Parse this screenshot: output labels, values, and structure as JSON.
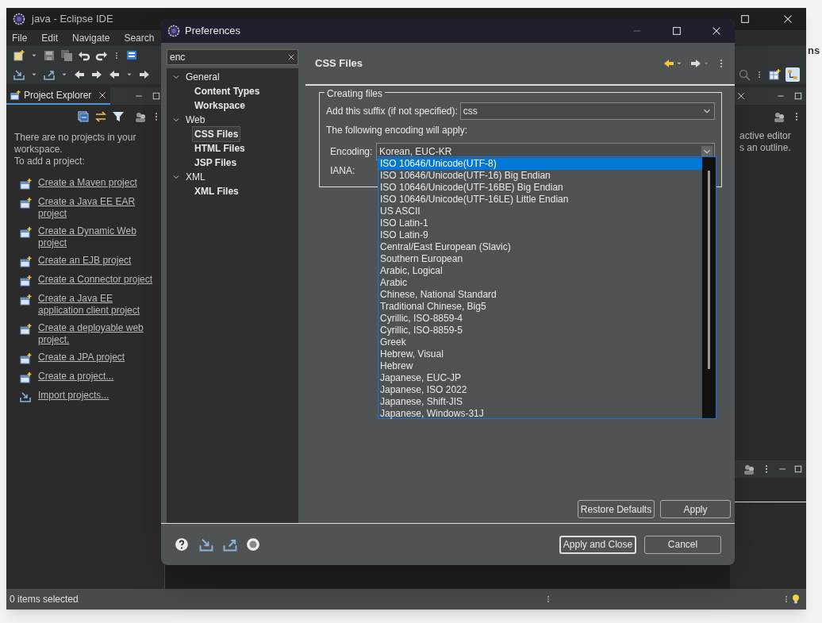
{
  "main_window": {
    "title": "java - Eclipse IDE",
    "menu": [
      "File",
      "Edit",
      "Navigate",
      "Search"
    ]
  },
  "project_explorer": {
    "tab": "Project Explorer",
    "message": "There are no projects in your workspace.",
    "prompt": "To add a project:",
    "links": [
      {
        "label": "Create a Maven project"
      },
      {
        "label": "Create a Java EE EAR project"
      },
      {
        "label": "Create a Dynamic Web project"
      },
      {
        "label": "Create an EJB project"
      },
      {
        "label": "Create a Connector project"
      },
      {
        "label": "Create a Java EE application client project"
      },
      {
        "label": "Create a deployable web project."
      },
      {
        "label": "Create a JPA project"
      },
      {
        "label": "Create a project..."
      },
      {
        "label": "Import projects..."
      }
    ]
  },
  "outline": {
    "lines": [
      "active editor",
      "s an outline."
    ]
  },
  "background_window": {
    "text": "ns"
  },
  "status_bar": {
    "text": "0 items selected"
  },
  "preferences": {
    "title": "Preferences",
    "filter": "enc",
    "tree": [
      {
        "label": "General",
        "expanded": true,
        "selected": false,
        "children": [
          {
            "label": "Content Types",
            "selected": false
          },
          {
            "label": "Workspace",
            "selected": false
          }
        ]
      },
      {
        "label": "Web",
        "expanded": true,
        "selected": false,
        "children": [
          {
            "label": "CSS Files",
            "selected": true
          },
          {
            "label": "HTML Files",
            "selected": false
          },
          {
            "label": "JSP Files",
            "selected": false
          }
        ]
      },
      {
        "label": "XML",
        "expanded": true,
        "selected": false,
        "children": [
          {
            "label": "XML Files",
            "selected": false
          }
        ]
      }
    ],
    "page_title": "CSS Files",
    "group_title": "Creating files",
    "suffix_label": "Add this suffix (if not specified):",
    "suffix_value": "css",
    "encoding_note": "The following encoding will apply:",
    "encoding_label": "Encoding:",
    "encoding_value": "Korean, EUC-KR",
    "iana_label": "IANA:",
    "encoding_options": [
      {
        "label": "ISO 10646/Unicode(UTF-8)",
        "selected": true
      },
      {
        "label": "ISO 10646/Unicode(UTF-16) Big Endian",
        "selected": false
      },
      {
        "label": "ISO 10646/Unicode(UTF-16BE) Big Endian",
        "selected": false
      },
      {
        "label": "ISO 10646/Unicode(UTF-16LE) Little Endian",
        "selected": false
      },
      {
        "label": "US ASCII",
        "selected": false
      },
      {
        "label": "ISO Latin-1",
        "selected": false
      },
      {
        "label": "ISO Latin-9",
        "selected": false
      },
      {
        "label": "Central/East European (Slavic)",
        "selected": false
      },
      {
        "label": "Southern European",
        "selected": false
      },
      {
        "label": "Arabic, Logical",
        "selected": false
      },
      {
        "label": "Arabic",
        "selected": false
      },
      {
        "label": "Chinese, National Standard",
        "selected": false
      },
      {
        "label": "Traditional Chinese, Big5",
        "selected": false
      },
      {
        "label": "Cyrillic, ISO-8859-4",
        "selected": false
      },
      {
        "label": "Cyrillic, ISO-8859-5",
        "selected": false
      },
      {
        "label": "Greek",
        "selected": false
      },
      {
        "label": "Hebrew, Visual",
        "selected": false
      },
      {
        "label": "Hebrew",
        "selected": false
      },
      {
        "label": "Japanese, EUC-JP",
        "selected": false
      },
      {
        "label": "Japanese, ISO 2022",
        "selected": false
      },
      {
        "label": "Japanese, Shift-JIS",
        "selected": false
      },
      {
        "label": "Japanese, Windows-31J",
        "selected": false
      }
    ],
    "page_buttons": [
      "Restore Defaults",
      "Apply"
    ],
    "dialog_buttons": [
      {
        "label": "Apply and Close",
        "default": true
      },
      {
        "label": "Cancel",
        "default": false
      }
    ]
  }
}
